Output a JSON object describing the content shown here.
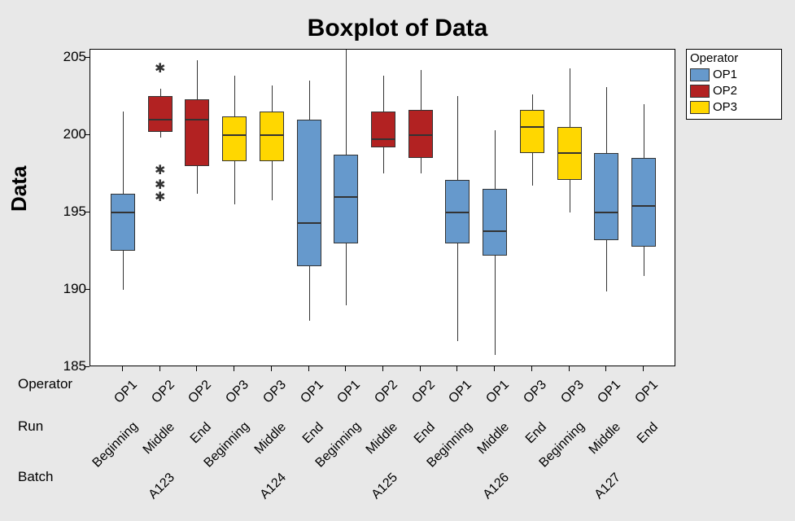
{
  "title": "Boxplot of Data",
  "ylabel": "Data",
  "y_ticks": [
    185,
    190,
    195,
    200,
    205
  ],
  "row_labels": {
    "operator": "Operator",
    "run": "Run",
    "batch": "Batch"
  },
  "legend": {
    "title": "Operator",
    "items": [
      {
        "label": "OP1",
        "color": "#6699cc"
      },
      {
        "label": "OP2",
        "color": "#b22222"
      },
      {
        "label": "OP3",
        "color": "#ffd700"
      }
    ]
  },
  "chart_data": {
    "type": "boxplot",
    "ylim": [
      185,
      205.5
    ],
    "ylabel": "Data",
    "title": "Boxplot of Data",
    "x_axis_levels": [
      "Operator",
      "Run",
      "Batch"
    ],
    "series": [
      {
        "batch": "A123",
        "run": "Beginning",
        "operator": "OP1",
        "color": "#6699cc",
        "q1": 192.5,
        "median": 195.0,
        "q3": 196.2,
        "whisker_low": 190.0,
        "whisker_high": 201.5,
        "outliers": []
      },
      {
        "batch": "A123",
        "run": "Middle",
        "operator": "OP2",
        "color": "#b22222",
        "q1": 200.2,
        "median": 201.0,
        "q3": 202.5,
        "whisker_low": 199.8,
        "whisker_high": 203.0,
        "outliers": [
          196.0,
          196.8,
          197.7,
          204.3
        ]
      },
      {
        "batch": "A123",
        "run": "End",
        "operator": "OP2",
        "color": "#b22222",
        "q1": 198.0,
        "median": 201.0,
        "q3": 202.3,
        "whisker_low": 196.2,
        "whisker_high": 204.8,
        "outliers": []
      },
      {
        "batch": "A124",
        "run": "Beginning",
        "operator": "OP3",
        "color": "#ffd700",
        "q1": 198.3,
        "median": 200.0,
        "q3": 201.2,
        "whisker_low": 195.5,
        "whisker_high": 203.8,
        "outliers": []
      },
      {
        "batch": "A124",
        "run": "Middle",
        "operator": "OP3",
        "color": "#ffd700",
        "q1": 198.3,
        "median": 200.0,
        "q3": 201.5,
        "whisker_low": 195.8,
        "whisker_high": 203.2,
        "outliers": []
      },
      {
        "batch": "A124",
        "run": "End",
        "operator": "OP1",
        "color": "#6699cc",
        "q1": 191.5,
        "median": 194.3,
        "q3": 201.0,
        "whisker_low": 188.0,
        "whisker_high": 203.5,
        "outliers": []
      },
      {
        "batch": "A125",
        "run": "Beginning",
        "operator": "OP1",
        "color": "#6699cc",
        "q1": 193.0,
        "median": 196.0,
        "q3": 198.7,
        "whisker_low": 189.0,
        "whisker_high": 205.5,
        "outliers": []
      },
      {
        "batch": "A125",
        "run": "Middle",
        "operator": "OP2",
        "color": "#b22222",
        "q1": 199.2,
        "median": 199.7,
        "q3": 201.5,
        "whisker_low": 197.5,
        "whisker_high": 203.8,
        "outliers": []
      },
      {
        "batch": "A125",
        "run": "End",
        "operator": "OP2",
        "color": "#b22222",
        "q1": 198.5,
        "median": 200.0,
        "q3": 201.6,
        "whisker_low": 197.5,
        "whisker_high": 204.2,
        "outliers": []
      },
      {
        "batch": "A126",
        "run": "Beginning",
        "operator": "OP1",
        "color": "#6699cc",
        "q1": 193.0,
        "median": 195.0,
        "q3": 197.1,
        "whisker_low": 186.7,
        "whisker_high": 202.5,
        "outliers": []
      },
      {
        "batch": "A126",
        "run": "Middle",
        "operator": "OP1",
        "color": "#6699cc",
        "q1": 192.2,
        "median": 193.8,
        "q3": 196.5,
        "whisker_low": 185.8,
        "whisker_high": 200.3,
        "outliers": []
      },
      {
        "batch": "A126",
        "run": "End",
        "operator": "OP3",
        "color": "#ffd700",
        "q1": 198.8,
        "median": 200.5,
        "q3": 201.6,
        "whisker_low": 196.7,
        "whisker_high": 202.6,
        "outliers": []
      },
      {
        "batch": "A127",
        "run": "Beginning",
        "operator": "OP3",
        "color": "#ffd700",
        "q1": 197.1,
        "median": 198.8,
        "q3": 200.5,
        "whisker_low": 195.0,
        "whisker_high": 204.3,
        "outliers": []
      },
      {
        "batch": "A127",
        "run": "Middle",
        "operator": "OP1",
        "color": "#6699cc",
        "q1": 193.2,
        "median": 195.0,
        "q3": 198.8,
        "whisker_low": 189.9,
        "whisker_high": 203.1,
        "outliers": []
      },
      {
        "batch": "A127",
        "run": "End",
        "operator": "OP1",
        "color": "#6699cc",
        "q1": 192.8,
        "median": 195.4,
        "q3": 198.5,
        "whisker_low": 190.9,
        "whisker_high": 202.0,
        "outliers": []
      }
    ],
    "batch_groups": [
      {
        "batch": "A123",
        "span": 3
      },
      {
        "batch": "A124",
        "span": 3
      },
      {
        "batch": "A125",
        "span": 3
      },
      {
        "batch": "A126",
        "span": 3
      },
      {
        "batch": "A127",
        "span": 3
      }
    ]
  }
}
